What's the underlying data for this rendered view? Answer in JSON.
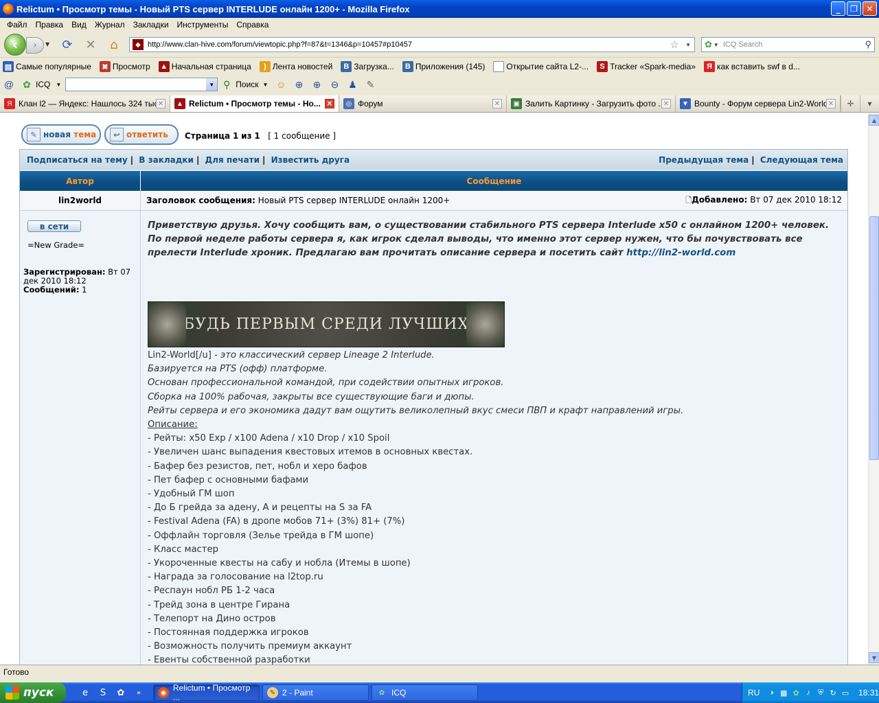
{
  "window": {
    "title": "Relictum • Просмотр темы - Новый PTS сервер INTERLUDE онлайн 1200+ - Mozilla Firefox",
    "minimize": "_",
    "maximize": "❐",
    "close": "✕"
  },
  "menu": [
    "Файл",
    "Правка",
    "Вид",
    "Журнал",
    "Закладки",
    "Инструменты",
    "Справка"
  ],
  "nav": {
    "url": "http://www.clan-hive.com/forum/viewtopic.php?f=87&t=1346&p=10457#p10457",
    "search_placeholder": "ICQ Search"
  },
  "bookmarks": [
    {
      "label": "Самые популярные",
      "icon": "bookmarks-icon",
      "color": "#2f5fb8"
    },
    {
      "label": "Просмотр",
      "icon": "yellow-x-icon",
      "color": "#c0392b"
    },
    {
      "label": "Начальная страница",
      "icon": "lin2-icon",
      "color": "#a01010"
    },
    {
      "label": "Лента новостей",
      "icon": "rss-icon",
      "color": "#e3a21a"
    },
    {
      "label": "Загрузка...",
      "icon": "vk-icon",
      "color": "#3c6aa3"
    },
    {
      "label": "Приложения (145)",
      "icon": "vk-icon",
      "color": "#3c6aa3"
    },
    {
      "label": "Открытие сайта L2-...",
      "icon": "page-icon",
      "color": "#8c8c8c"
    },
    {
      "label": "Tracker «Spark-media»",
      "icon": "spark-icon",
      "color": "#b01818"
    },
    {
      "label": "как вставить swf в d...",
      "icon": "yandex-icon",
      "color": "#d22"
    }
  ],
  "icqbar": {
    "label": "ICQ",
    "search_label": "Поиск"
  },
  "tabs": [
    {
      "label": "Клан l2 — Яндекс: Нашлось 324 тыс...",
      "icon": "yandex-icon",
      "color": "#d22",
      "active": false
    },
    {
      "label": "Relictum • Просмотр темы - Но...",
      "icon": "lin2-icon",
      "color": "#a01010",
      "active": true
    },
    {
      "label": "Форум",
      "icon": "forum-icon",
      "color": "#4c6fb5",
      "active": false
    },
    {
      "label": "Залить Картинку - Загрузить фото ...",
      "icon": "image-icon",
      "color": "#3b7a3b",
      "active": false
    },
    {
      "label": "Bounty - Форум сервера Lin2-World.c...",
      "icon": "bounty-icon",
      "color": "#3565b8",
      "active": false
    }
  ],
  "forum": {
    "new_topic": {
      "w1": "новая",
      "w2": "тема"
    },
    "reply": {
      "w1": "ответить",
      "w2": ""
    },
    "pagination": {
      "prefix": "Страница",
      "current": "1",
      "of": "из",
      "total": "1",
      "count": "[ 1 сообщение ]"
    },
    "links_left": [
      "Подписаться на тему",
      "В закладки",
      "Для печати",
      "Известить друга"
    ],
    "links_right": [
      "Предыдущая тема",
      "Следующая тема"
    ],
    "head_author": "Автор",
    "head_message": "Сообщение",
    "author": "lin2world",
    "subject_label": "Заголовок сообщения:",
    "subject": "Новый PTS сервер INTERLUDE онлайн 1200+",
    "posted_label": "Добавлено:",
    "posted": "Вт 07 дек 2010 18:12",
    "online": "в сети",
    "rank": "=New Grade=",
    "registered_label": "Зарегистрирован:",
    "registered": "Вт 07 дек 2010 18:12",
    "posts_label": "Сообщений:",
    "posts": "1",
    "intro": "Приветствую друзья. Хочу сообщить вам, о существовании стабильного PTS сервера Interlude x50 с онлайном 1200+ человек. По первой неделе работы сервера я, как игрок сделал выводы, что именно этот сервер нужен, что бы почувствовать все прелести Interlude хроник. Предлагаю вам прочитать описание сервера и посетить сайт",
    "intro_link": "http://lin2-world.com",
    "banner_text": "БУДЬ ПЕРВЫМ СРЕДИ ЛУЧШИХ",
    "lines_first": "Lin2-World[/u]",
    "lines_first_rest": " - это классический сервер Lineage 2 Interlude.",
    "lines_italic": [
      "Базируется на PTS (офф) платформе.",
      "Основан профессиональной командой, при содействии опытных игроков.",
      "Сборка на 100% рабочая, закрыты все существующие баги и дюпы.",
      "Рейты сервера и его экономика дадут вам ощутить великолепный вкус смеси ПВП и крафт направлений игры."
    ],
    "desc_label": "Описание:",
    "features": [
      "- Рейты: x50 Exp / x100 Adena / x10 Drop / x10 Spoil",
      "- Увеличен шанс выпадения квестовых итемов в основных квестах.",
      "- Бафер без резистов, пет, нобл и херо бафов",
      "- Пет бафер с основными бафами",
      "- Удобный ГМ шоп",
      "- До Б грейда за адену, А и рецепты на S за FA",
      "- Festival Adena (FA) в дропе мобов 71+ (3%) 81+ (7%)",
      "- Оффлайн торговля (Зелье трейда в ГМ шопе)",
      "- Класс мастер",
      "- Укороченные квесты на сабу и нобла (Итемы в шопе)",
      "- Награда за голосование на l2top.ru",
      "- Респаун нобл РБ 1-2 часа",
      "- Трейд зона в центре Гирана",
      "- Телепорт на Дино остров",
      "- Постоянная поддержка игроков",
      "- Возможность получить премиум аккаунт",
      "- Евенты собственной разработки"
    ]
  },
  "status": "Готово",
  "taskbar": {
    "start": "пуск",
    "items": [
      {
        "label": "Relictum • Просмотр ...",
        "icon": "firefox-icon",
        "active": true
      },
      {
        "label": "2 - Paint",
        "icon": "paint-icon",
        "active": false
      },
      {
        "label": "ICQ",
        "icon": "icq-icon",
        "active": false
      }
    ],
    "lang": "RU",
    "clock": "18:31"
  }
}
